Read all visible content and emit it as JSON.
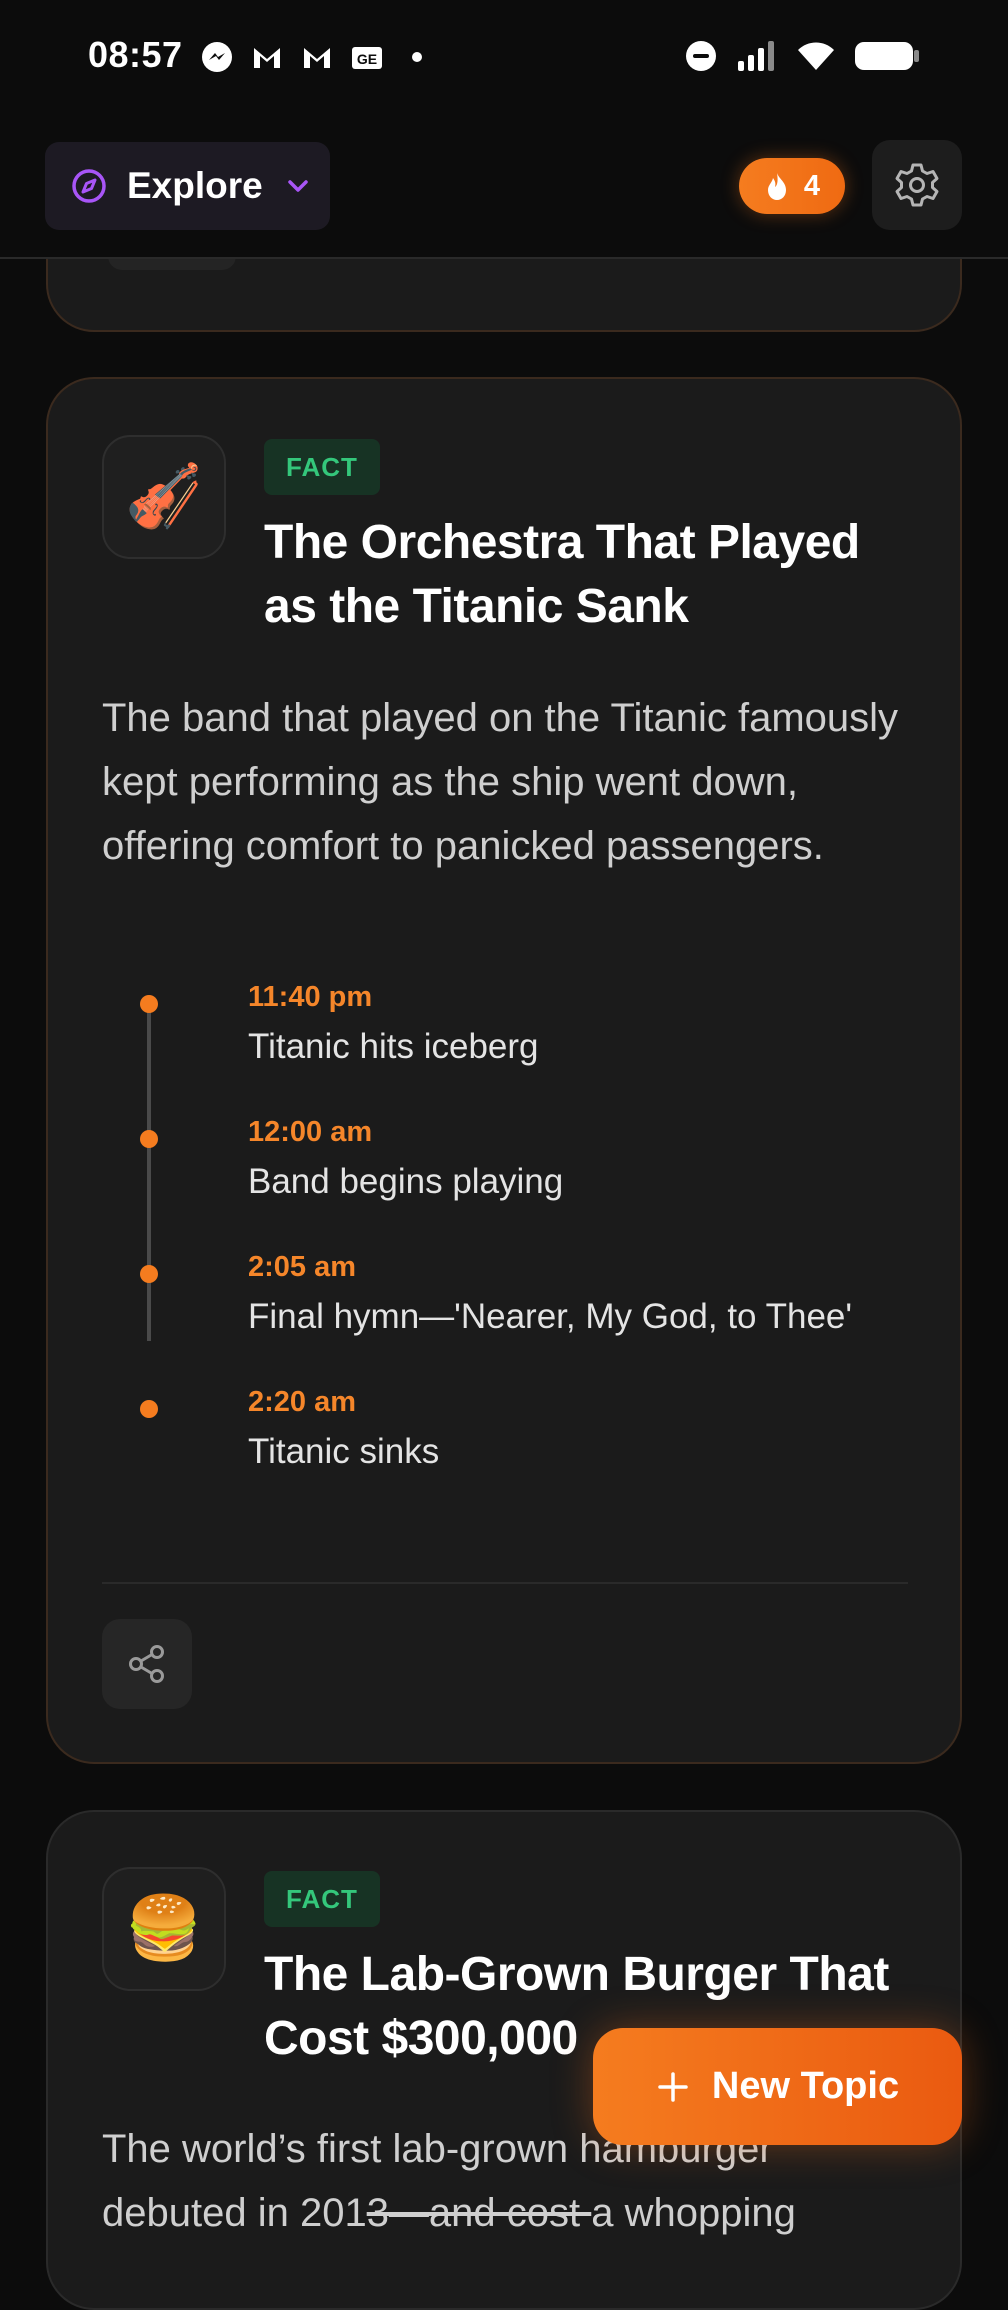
{
  "status_bar": {
    "time": "08:57",
    "left_icons": [
      "messenger-icon",
      "gmail-icon",
      "gmail-icon",
      "news-icon",
      "dot-icon"
    ],
    "right_icons": [
      "dnd-icon",
      "signal-icon",
      "wifi-icon",
      "battery-icon"
    ]
  },
  "header": {
    "explore_label": "Explore",
    "streak_count": "4",
    "accent": "#a855f7",
    "streak_color": "#f57c1f"
  },
  "cards": [
    {
      "emoji": "🎻",
      "badge": "FACT",
      "title": "The Orchestra That Played as the Titanic Sank",
      "body": "The band that played on the Titanic famously kept performing as the ship went down, offering comfort to panicked passengers.",
      "timeline": [
        {
          "time": "11:40 pm",
          "event": "Titanic hits iceberg"
        },
        {
          "time": "12:00 am",
          "event": "Band begins playing"
        },
        {
          "time": "2:05 am",
          "event": "Final hymn—'Nearer, My God, to Thee'"
        },
        {
          "time": "2:20 am",
          "event": "Titanic sinks"
        }
      ]
    },
    {
      "emoji": "🍔",
      "badge": "FACT",
      "title": "The Lab-Grown Burger That Cost $300,000",
      "body_line1": "The world’s first lab-grown hamburger",
      "body_line2_a": "debuted in 201",
      "body_line2_strike": "3—and cost ",
      "body_line2_b": "a whopping"
    }
  ],
  "fab": {
    "label": "New Topic"
  }
}
